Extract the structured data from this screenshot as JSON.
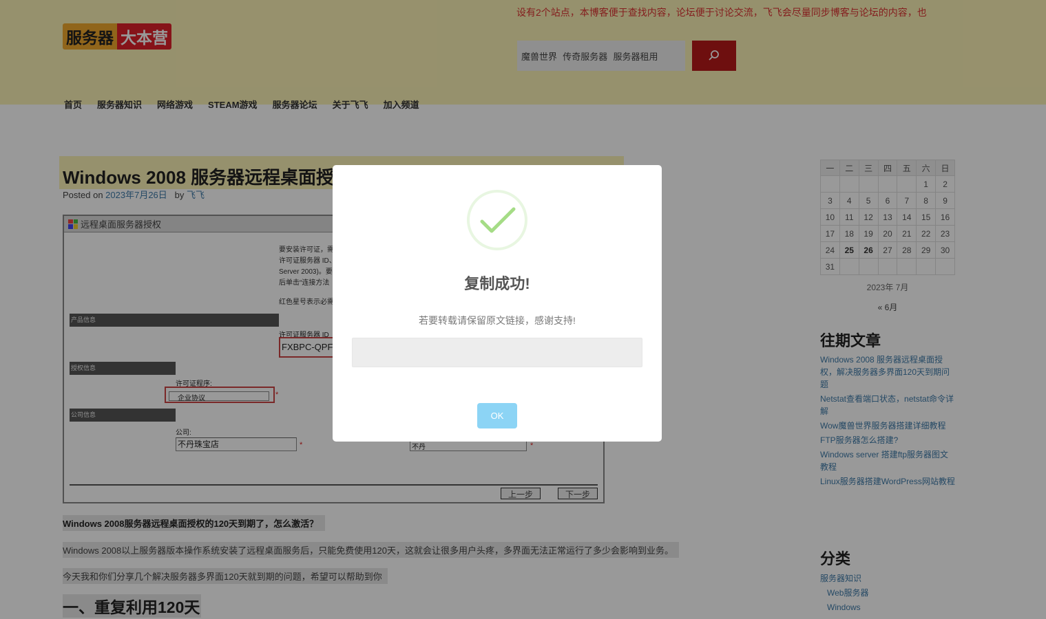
{
  "header": {
    "notice": "设有2个站点，本博客便于查找内容，论坛便于讨论交流，飞飞会尽量同步博客与论坛的内容，也",
    "logo_part1": "服务器",
    "logo_part2": "大本营",
    "search_value": "魔兽世界  传奇服务器  服务器租用",
    "search_icon": "search-icon"
  },
  "nav": [
    "首页",
    "服务器知识",
    "网络游戏",
    "STEAM游戏",
    "服务器论坛",
    "关于飞飞",
    "加入频道"
  ],
  "article": {
    "title": "Windows 2008 服务器远程桌面授",
    "meta_posted": "Posted on",
    "meta_date": "2023年7月26日",
    "meta_by": "by",
    "meta_author": "飞飞",
    "screenshot": {
      "window_title": "远程桌面服务器授权",
      "intro_lines": [
        "要安装许可证，需",
        "许可证服务器 ID、",
        "Server 2003)。要",
        "后单击“连接方法"
      ],
      "required_note": "红色星号表示必需",
      "section_product": "产品信息",
      "license_server_id_label": "许可证服务器 ID",
      "license_server_id_value": "FXBPC-QPF",
      "section_license": "授权信息",
      "license_program_label": "许可证程序:",
      "license_program_value": "企业协议",
      "section_company": "公司信息",
      "company_label": "公司:",
      "company_value": "不丹珠宝店",
      "country_value": "不丹",
      "back_button": "上一步",
      "next_button": "下一步"
    },
    "para1": "Windows 2008服务器远程桌面授权的120天到期了，怎么激活？",
    "para2": "Windows 2008以上服务器版本操作系统安装了远程桌面服务后，只能免费使用120天，这就会让很多用户头疼，多界面无法正常运行了多少会影响到业务。",
    "para3": "今天我和你们分享几个解决服务器多界面120天就到期的问题，希望可以帮助到你",
    "heading1": "一、重复利用120天"
  },
  "calendar": {
    "weekdays": [
      "一",
      "二",
      "三",
      "四",
      "五",
      "六",
      "日"
    ],
    "weeks": [
      [
        "",
        "",
        "",
        "",
        "",
        "1",
        "2"
      ],
      [
        "3",
        "4",
        "5",
        "6",
        "7",
        "8",
        "9"
      ],
      [
        "10",
        "11",
        "12",
        "13",
        "14",
        "15",
        "16"
      ],
      [
        "17",
        "18",
        "19",
        "20",
        "21",
        "22",
        "23"
      ],
      [
        "24",
        "25",
        "26",
        "27",
        "28",
        "29",
        "30"
      ],
      [
        "31",
        "",
        "",
        "",
        "",
        "",
        ""
      ]
    ],
    "bold_days": [
      "25",
      "26"
    ],
    "caption": "2023年 7月",
    "prev_link": "« 6月"
  },
  "recent": {
    "title": "往期文章",
    "items": [
      "Windows 2008 服务器远程桌面授权，解决服务器多界面120天到期问题",
      "Netstat查看端口状态，netstat命令详解",
      "Wow魔兽世界服务器搭建详细教程",
      "FTP服务器怎么搭建?",
      "Windows server 搭建ftp服务器图文教程",
      "Linux服务器搭建WordPress网站教程"
    ]
  },
  "categories": {
    "title": "分类",
    "items": [
      "服务器知识",
      "Web服务器",
      "Windows"
    ]
  },
  "modal": {
    "icon": "success-check-icon",
    "title": "复制成功!",
    "text": "若要转载请保留原文链接，感谢支持!",
    "input_value": "",
    "ok_label": "OK"
  },
  "colors": {
    "header_bg": "#fbf2b6",
    "search_button": "#b71a1a",
    "ok_button": "#8cd4f5",
    "success_green": "#a5dc86"
  }
}
